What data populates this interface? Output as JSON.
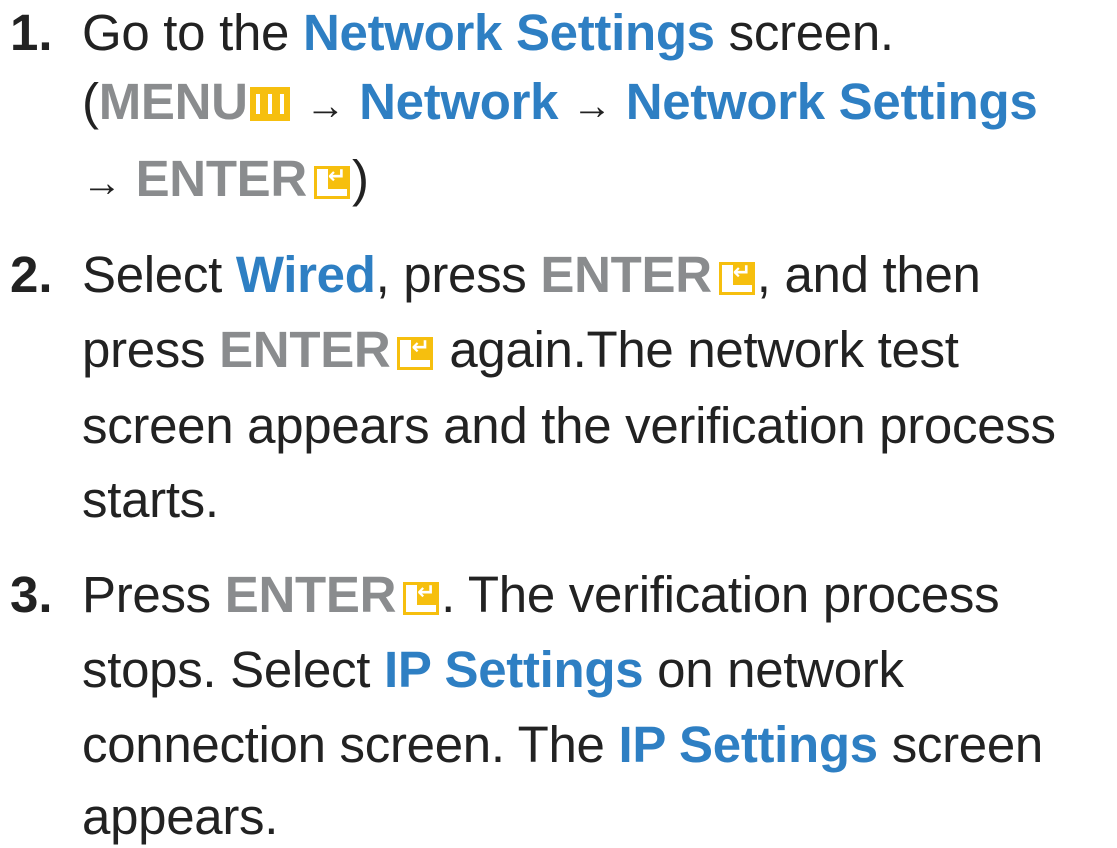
{
  "steps": [
    {
      "number": "1.",
      "go_to": "Go to the",
      "network_settings": "Network Settings",
      "screen": "screen.",
      "open_paren": "(",
      "menu": "MENU",
      "arrow": "→",
      "network": "Network",
      "network_settings_2": "Network Settings",
      "enter": "ENTER",
      "close_paren": ")"
    },
    {
      "number": "2.",
      "select": "Select",
      "wired": "Wired",
      "comma_press": ", press",
      "enter": "ENTER",
      "and_then": ", and then",
      "press": "press",
      "again": "again.The network test",
      "line3": "screen appears and the verification process",
      "line4": "starts."
    },
    {
      "number": "3.",
      "press": "Press",
      "enter": "ENTER",
      "after_enter": ". The verification process",
      "stops_select": "stops. Select",
      "ip_settings": "IP Settings",
      "on_network": "on network",
      "connection_screen": "connection screen. The",
      "ip_settings_2": "IP Settings",
      "screen": "screen",
      "appears": "appears."
    }
  ],
  "icons": {
    "menu": "menu-icon",
    "enter": "enter-icon"
  },
  "colors": {
    "highlight_blue": "#2e7fc3",
    "key_gray": "#8a8c8e",
    "icon_yellow": "#f6bf0e",
    "text": "#222222"
  }
}
